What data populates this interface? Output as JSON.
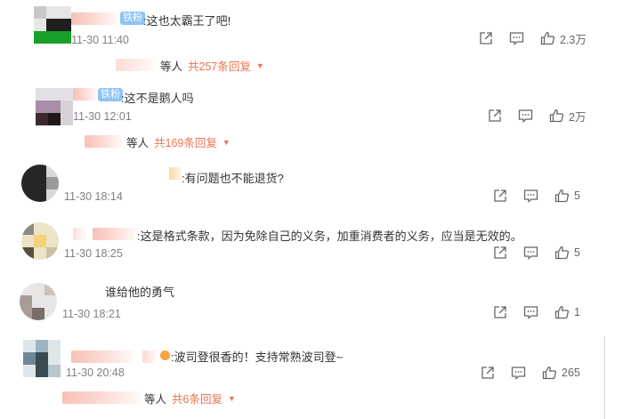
{
  "comments": [
    {
      "badge": "铁粉",
      "text": ":这也太霸王了吧!",
      "time": "11-30 11:40",
      "likes": "2.3万",
      "replies": {
        "who": "等人",
        "total": "共257条回复"
      }
    },
    {
      "badge": "铁粉",
      "text": ":这不是鹅人吗",
      "time": "11-30 12:01",
      "likes": "2万",
      "replies": {
        "who": "等人",
        "total": "共169条回复"
      }
    },
    {
      "text": ":有问题也不能退货?",
      "time": "11-30 18:14",
      "likes": "5"
    },
    {
      "text": ":这是格式条款，因为免除自己的义务，加重消费者的义务，应当是无效的。",
      "time": "11-30 18:25",
      "likes": "5"
    },
    {
      "text": "谁给他的勇气",
      "time": "11-30 18:21",
      "likes": "1"
    },
    {
      "text": ":波司登很香的！支持常熟波司登~",
      "time": "11-30 20:48",
      "likes": "265",
      "replies": {
        "who": "等人",
        "total": "共6条回复"
      }
    }
  ],
  "icons": {
    "share": "share-icon",
    "comment": "comment-icon",
    "like": "thumbs-up-icon",
    "expand": "caret-down-icon"
  },
  "colors": {
    "accent": "#eb7350",
    "badge": "#8ec3f4",
    "muted": "#808080"
  }
}
